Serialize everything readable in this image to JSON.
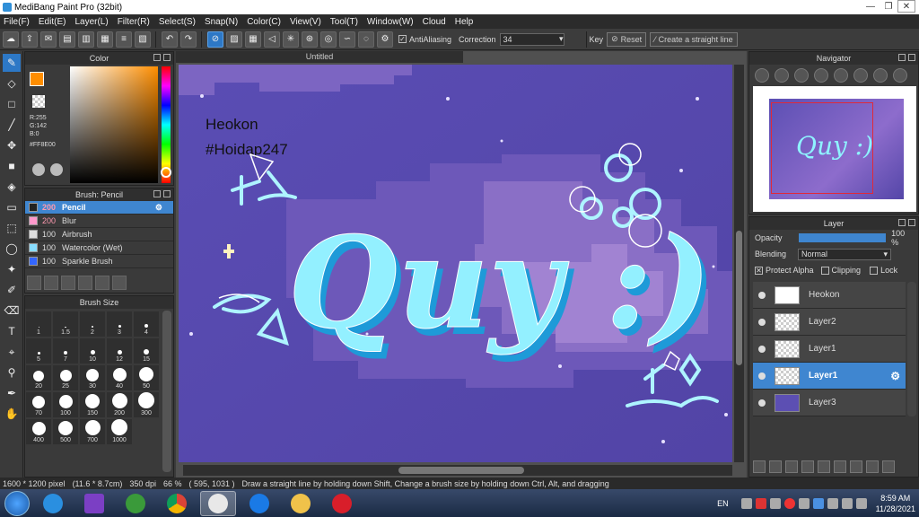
{
  "window": {
    "title": "MediBang Paint Pro (32bit)",
    "minimize": "—",
    "maximize": "❐",
    "close": "✕"
  },
  "menu": [
    "File(F)",
    "Edit(E)",
    "Layer(L)",
    "Filter(R)",
    "Select(S)",
    "Snap(N)",
    "Color(C)",
    "View(V)",
    "Tool(T)",
    "Window(W)",
    "Cloud",
    "Help"
  ],
  "toolbar": {
    "antialiasing_label": "AntiAliasing",
    "correction_label": "Correction",
    "correction_value": "34",
    "key_label": "Key",
    "reset_label": "Reset",
    "straight_line_label": "Create a straight line"
  },
  "color_panel": {
    "title": "Color",
    "r": "R:255",
    "g": "G:142",
    "b": "B:0",
    "hex": "#FF8E00",
    "fg_color": "#ff8e00"
  },
  "brush_panel": {
    "title": "Brush: Pencil",
    "items": [
      {
        "size": "200",
        "name": "Pencil",
        "color": "#222222",
        "active": true
      },
      {
        "size": "200",
        "name": "Blur",
        "color": "#ff99cc",
        "active": false
      },
      {
        "size": "100",
        "name": "Airbrush",
        "color": "#dddddd",
        "active": false
      },
      {
        "size": "100",
        "name": "Watercolor (Wet)",
        "color": "#88ddff",
        "active": false
      },
      {
        "size": "100",
        "name": "Sparkle Brush",
        "color": "#3366ff",
        "active": false
      }
    ]
  },
  "size_panel": {
    "title": "Brush Size",
    "sizes": [
      "1",
      "1.5",
      "2",
      "3",
      "4",
      "5",
      "7",
      "10",
      "12",
      "15",
      "20",
      "25",
      "30",
      "40",
      "50",
      "70",
      "100",
      "150",
      "200",
      "300",
      "400",
      "500",
      "700",
      "1000"
    ]
  },
  "canvas": {
    "tab_title": "Untitled",
    "credit_name": "Heokon",
    "credit_handle": "#Hoidap247",
    "main_text": "Quy :)"
  },
  "navigator": {
    "title": "Navigator",
    "preview_text": "Quy :)"
  },
  "layer_panel": {
    "title": "Layer",
    "opacity_label": "Opacity",
    "opacity_value": "100 %",
    "blending_label": "Blending",
    "blending_value": "Normal",
    "protect_alpha": "Protect Alpha",
    "clipping": "Clipping",
    "lock": "Lock",
    "layers": [
      "Heokon",
      "Layer2",
      "Layer1",
      "Layer1",
      "Layer3"
    ],
    "active_index": 3
  },
  "status": {
    "dimensions": "1600 * 1200 pixel",
    "cm": "(11.6 * 8.7cm)",
    "dpi": "350 dpi",
    "zoom": "66 %",
    "coords": "( 595, 1031 )",
    "hint": "Draw a straight line by holding down Shift, Change a brush size by holding down Ctrl, Alt, and dragging"
  },
  "taskbar": {
    "lang": "EN",
    "time": "8:59 AM",
    "date": "11/28/2021"
  }
}
